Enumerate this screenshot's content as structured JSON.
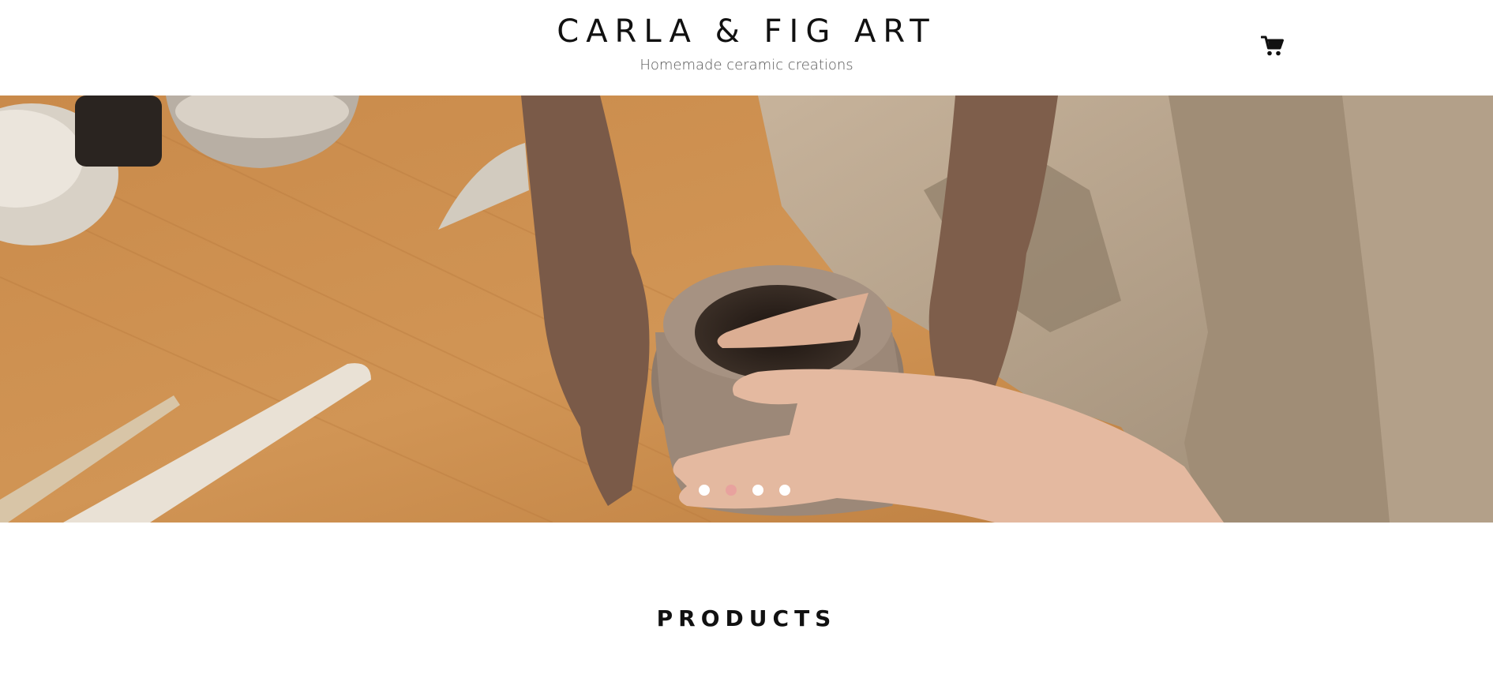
{
  "header": {
    "title": "CARLA & FIG ART",
    "subtitle": "Homemade ceramic creations",
    "cart_icon": "shopping-cart-icon"
  },
  "hero": {
    "image_alt": "Hands shaping a clay pot on a wooden workbench",
    "slides_total": 4,
    "active_slide": 2,
    "active_dot_color": "#e8a29e"
  },
  "products": {
    "heading": "PRODUCTS"
  }
}
